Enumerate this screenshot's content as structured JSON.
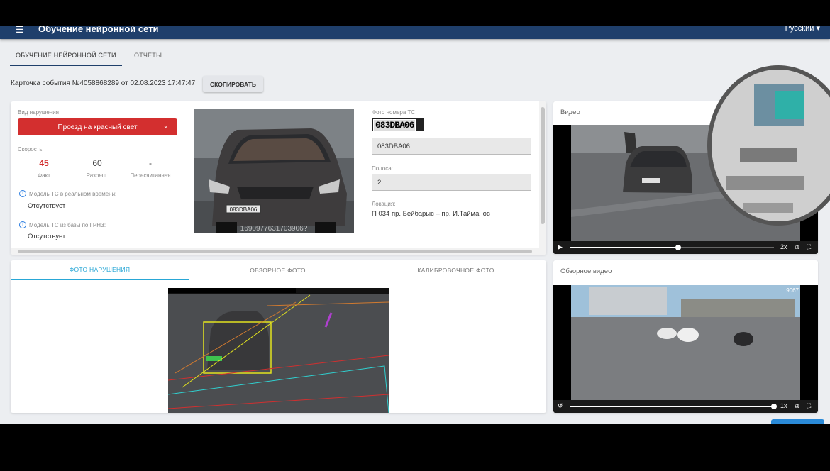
{
  "appbar": {
    "menu_icon": "menu-icon",
    "title": "Обучение нейронной сети",
    "user": "Русский ▾"
  },
  "tabs": [
    {
      "label": "ОБУЧЕНИЕ НЕЙРОННОЙ СЕТИ",
      "active": true
    },
    {
      "label": "ОТЧЕТЫ",
      "active": false
    }
  ],
  "event": {
    "card_text": "Карточка события №4058868289 от 02.08.2023 17:47:47",
    "copy_label": "СКОПИРОВАТЬ"
  },
  "violation": {
    "type_label": "Вид нарушения",
    "type_value": "Проезд на красный свет",
    "speed_label": "Скорость:",
    "speeds": [
      {
        "value": "45",
        "caption": "Факт"
      },
      {
        "value": "60",
        "caption": "Разреш."
      },
      {
        "value": "-",
        "caption": "Пересчитанная"
      }
    ],
    "model_rt_label": "Модель ТС в реальном времени:",
    "model_rt_value": "Отсутствует",
    "model_db_label": "Модель ТС из базы по ГРНЗ:",
    "model_db_value": "Отсутствует",
    "photo_overlay_text": "1690977631703906?",
    "plate_photo_label": "Фото номера ТС:",
    "plate_image_text": "083DBA06",
    "plate_value": "083DBA06",
    "lane_label": "Полоса:",
    "lane_value": "2",
    "location_label": "Локация:",
    "location_value": "П 034 пр. Бейбарыс – пр. И.Тайманов"
  },
  "video": {
    "title": "Видео",
    "speed": "2x",
    "progress": 0.53
  },
  "overview_video": {
    "title": "Обзорное видео",
    "speed": "1x",
    "progress": 1.0,
    "overlay_text": "9067"
  },
  "photo_tabs": [
    {
      "label": "ФОТО НАРУШЕНИЯ",
      "active": true
    },
    {
      "label": "ОБЗОРНОЕ ФОТО",
      "active": false
    },
    {
      "label": "КАЛИБРОВОЧНОЕ ФОТО",
      "active": false
    }
  ],
  "colors": {
    "appbar": "#1f3f6b",
    "violation": "#d32f2f",
    "accent": "#29a7d6"
  }
}
